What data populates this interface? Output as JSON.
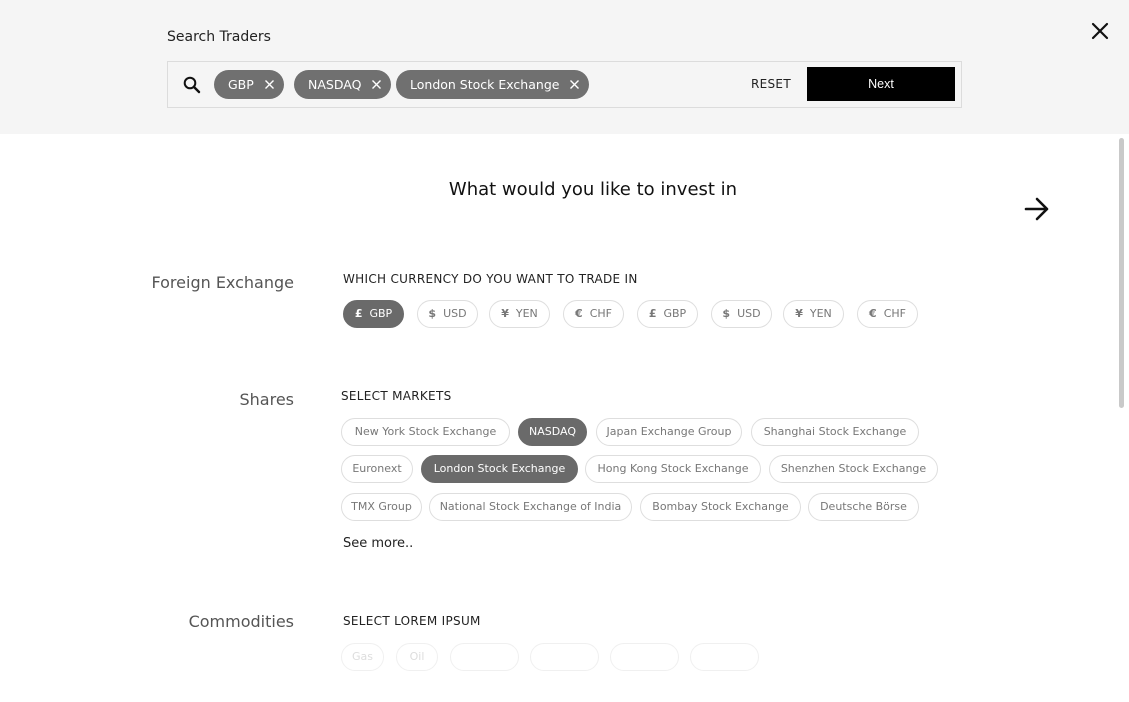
{
  "header": {
    "title": "Search Traders",
    "chips": [
      {
        "label": "GBP"
      },
      {
        "label": "NASDAQ"
      },
      {
        "label": "London Stock Exchange"
      }
    ],
    "reset_label": "RESET",
    "next_label": "Next"
  },
  "main": {
    "title": "What would you like to invest in"
  },
  "sections": {
    "forex": {
      "label": "Foreign Exchange",
      "subtitle": "WHICH CURRENCY DO YOU WANT TO TRADE IN",
      "currencies": [
        {
          "symbol": "£",
          "label": "GBP",
          "active": true
        },
        {
          "symbol": "$",
          "label": "USD",
          "active": false
        },
        {
          "symbol": "¥",
          "label": "YEN",
          "active": false
        },
        {
          "symbol": "€",
          "label": "CHF",
          "active": false
        },
        {
          "symbol": "£",
          "label": "GBP",
          "active": false
        },
        {
          "symbol": "$",
          "label": "USD",
          "active": false
        },
        {
          "symbol": "¥",
          "label": "YEN",
          "active": false
        },
        {
          "symbol": "€",
          "label": "CHF",
          "active": false
        }
      ]
    },
    "shares": {
      "label": "Shares",
      "subtitle": "SELECT MARKETS",
      "markets": [
        {
          "label": "New York Stock Exchange",
          "active": false
        },
        {
          "label": "NASDAQ",
          "active": true
        },
        {
          "label": "Japan Exchange Group",
          "active": false
        },
        {
          "label": "Shanghai Stock Exchange",
          "active": false
        },
        {
          "label": "Euronext",
          "active": false
        },
        {
          "label": "London Stock Exchange",
          "active": true
        },
        {
          "label": "Hong Kong Stock Exchange",
          "active": false
        },
        {
          "label": "Shenzhen Stock Exchange",
          "active": false
        },
        {
          "label": "TMX Group",
          "active": false
        },
        {
          "label": "National Stock Exchange of India",
          "active": false
        },
        {
          "label": "Bombay Stock Exchange",
          "active": false
        },
        {
          "label": "Deutsche Börse",
          "active": false
        }
      ],
      "see_more": "See more.."
    },
    "commodities": {
      "label": "Commodities",
      "subtitle": "SELECT LOREM IPSUM",
      "items": [
        {
          "label": "Gas"
        },
        {
          "label": "Oil"
        },
        {
          "label": ""
        },
        {
          "label": ""
        },
        {
          "label": ""
        },
        {
          "label": ""
        }
      ]
    }
  },
  "icons": {
    "search": "search-icon",
    "close": "close-icon",
    "chip_remove": "close-icon",
    "next_arrow": "arrow-right-icon"
  }
}
